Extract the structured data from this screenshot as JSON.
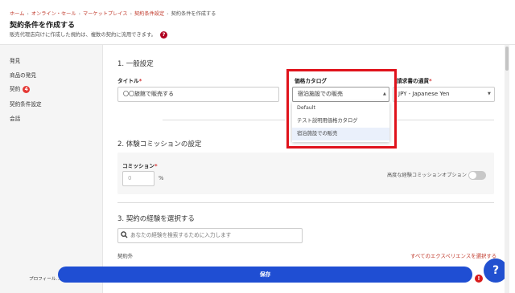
{
  "breadcrumb": {
    "items": [
      "ホーム",
      "オンライン・セール",
      "マーケットプレイス",
      "契約条件設定",
      "契約条件を作成する"
    ]
  },
  "page": {
    "title": "契約条件を作成する",
    "description": "販売代理店向けに作成した規約は、複数の契約に流用できます。",
    "help_glyph": "?"
  },
  "sidebar": {
    "items": [
      {
        "label": "発見"
      },
      {
        "label": "商品の発見"
      },
      {
        "label": "契約",
        "badge": "4"
      },
      {
        "label": "契約条件設定"
      },
      {
        "label": "会話"
      }
    ],
    "profile_label": "プロフィール…"
  },
  "general": {
    "section_title": "1. 一般設定",
    "title_label": "タイトル",
    "title_value": "〇〇旅館で販売する",
    "catalog_label": "価格カタログ",
    "catalog_value": "宿泊施設での販売",
    "currency_label": "請求書の通貨",
    "currency_value": "JPY - Japanese Yen",
    "catalog_options": [
      "Default",
      "テスト説明用価格カタログ",
      "宿泊施設での販売"
    ],
    "required_mark": "*"
  },
  "commission": {
    "section_title": "2. 体験コミッションの設定",
    "label": "コミッション",
    "placeholder": "0",
    "unit": "%",
    "advanced_label": "高度な経験コミッションオプション"
  },
  "experiences": {
    "section_title": "3. 契約の経験を選択する",
    "search_placeholder": "あなたの経験を検索するために入力します",
    "excluded_label": "契約外",
    "select_all_link": "すべてのエクスペリエンスを選択する"
  },
  "footer": {
    "save_label": "保存",
    "warning_glyph": "!",
    "help_glyph": "?"
  },
  "colors": {
    "accent_red": "#c0392b",
    "primary_blue": "#1f4ed3",
    "highlight_box": "#e0121b"
  }
}
